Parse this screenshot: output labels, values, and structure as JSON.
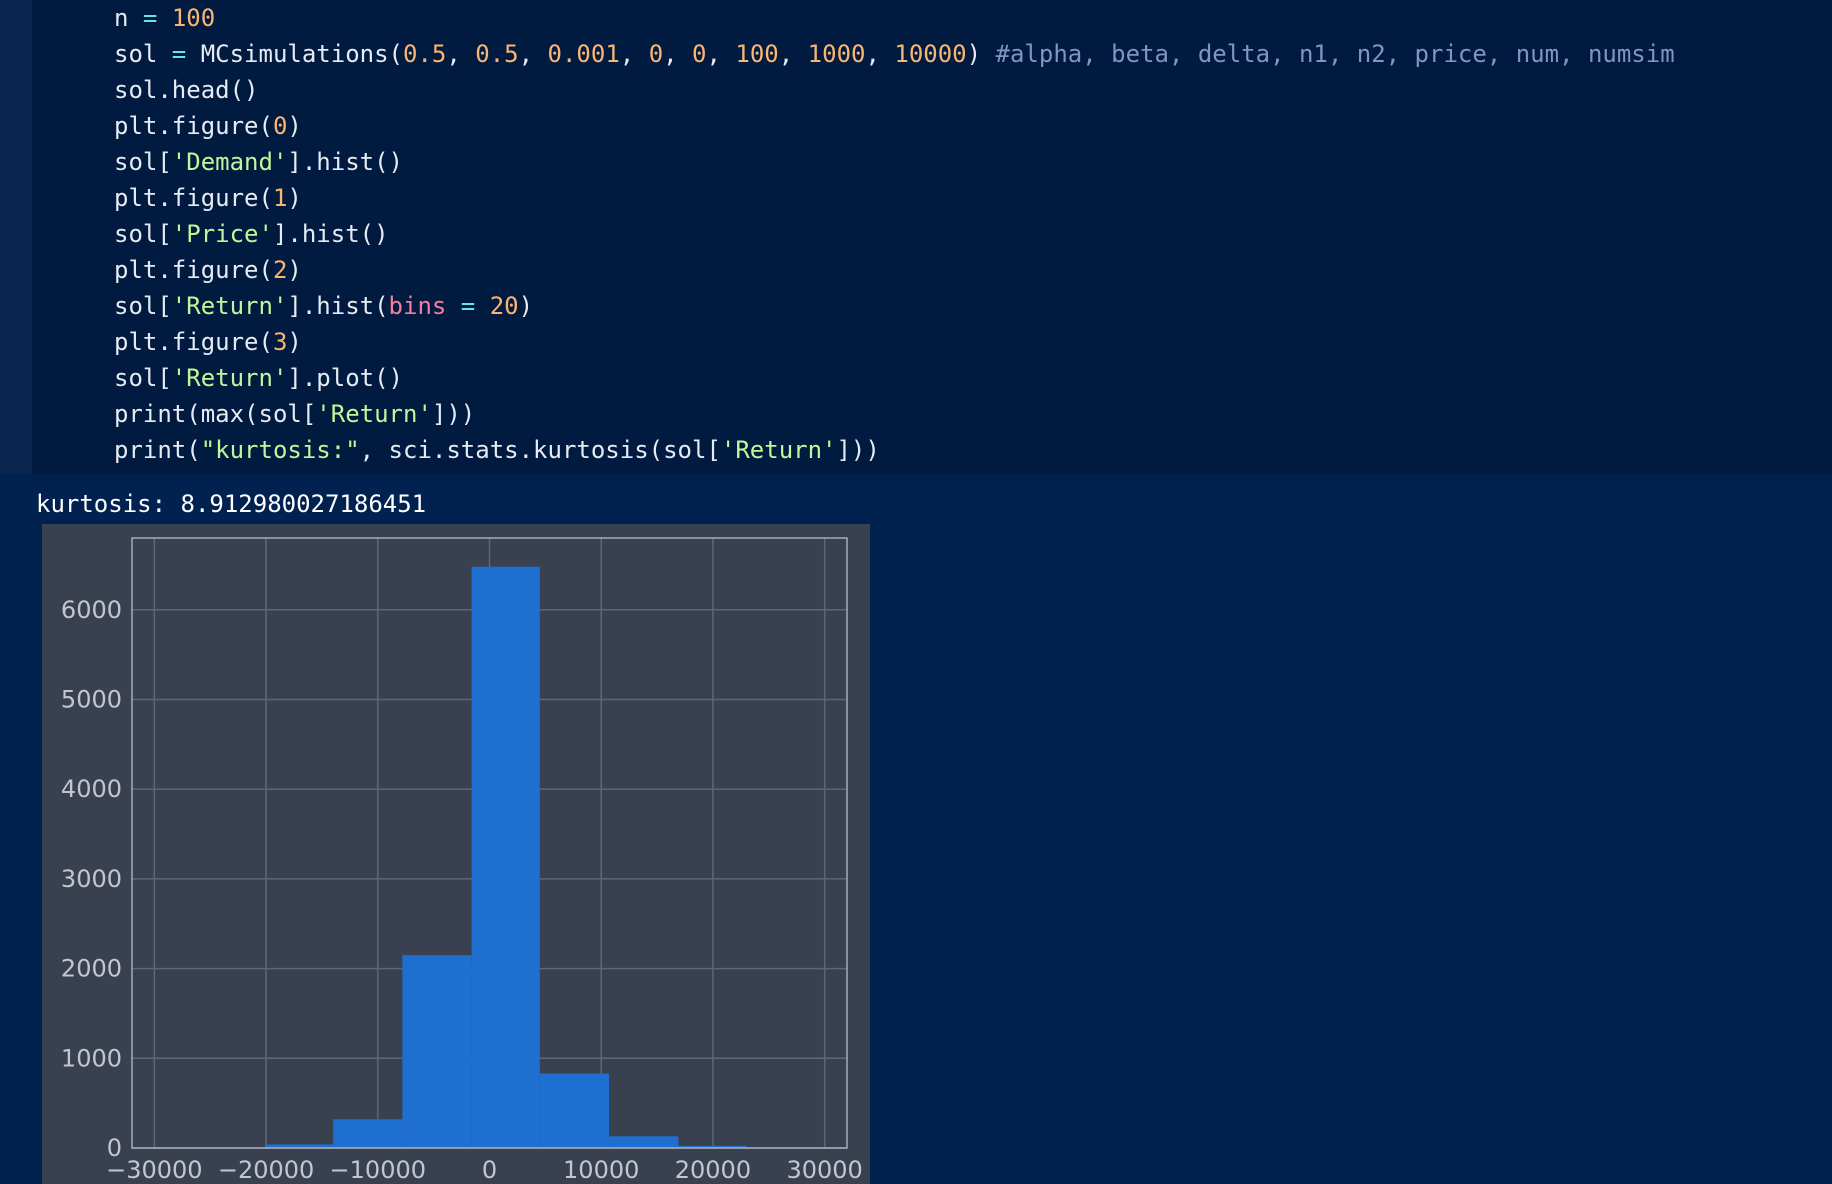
{
  "code_cell": {
    "lines": [
      [
        {
          "t": "n ",
          "c": "txt"
        },
        {
          "t": "=",
          "c": "op"
        },
        {
          "t": " ",
          "c": "txt"
        },
        {
          "t": "100",
          "c": "num"
        }
      ],
      [
        {
          "t": "sol ",
          "c": "txt"
        },
        {
          "t": "=",
          "c": "op"
        },
        {
          "t": " MCsimulations(",
          "c": "txt"
        },
        {
          "t": "0.5",
          "c": "num"
        },
        {
          "t": ", ",
          "c": "txt"
        },
        {
          "t": "0.5",
          "c": "num"
        },
        {
          "t": ", ",
          "c": "txt"
        },
        {
          "t": "0.001",
          "c": "num"
        },
        {
          "t": ", ",
          "c": "txt"
        },
        {
          "t": "0",
          "c": "num"
        },
        {
          "t": ", ",
          "c": "txt"
        },
        {
          "t": "0",
          "c": "num"
        },
        {
          "t": ", ",
          "c": "txt"
        },
        {
          "t": "100",
          "c": "num"
        },
        {
          "t": ", ",
          "c": "txt"
        },
        {
          "t": "1000",
          "c": "num"
        },
        {
          "t": ", ",
          "c": "txt"
        },
        {
          "t": "10000",
          "c": "num"
        },
        {
          "t": ") ",
          "c": "txt"
        },
        {
          "t": "#alpha, beta, delta, n1, n2, price, num, numsim",
          "c": "com"
        }
      ],
      [
        {
          "t": "sol.head()",
          "c": "txt"
        }
      ],
      [
        {
          "t": "plt.figure(",
          "c": "txt"
        },
        {
          "t": "0",
          "c": "num"
        },
        {
          "t": ")",
          "c": "txt"
        }
      ],
      [
        {
          "t": "sol[",
          "c": "txt"
        },
        {
          "t": "'Demand'",
          "c": "str"
        },
        {
          "t": "].hist()",
          "c": "txt"
        }
      ],
      [
        {
          "t": "plt.figure(",
          "c": "txt"
        },
        {
          "t": "1",
          "c": "num"
        },
        {
          "t": ")",
          "c": "txt"
        }
      ],
      [
        {
          "t": "sol[",
          "c": "txt"
        },
        {
          "t": "'Price'",
          "c": "str"
        },
        {
          "t": "].hist()",
          "c": "txt"
        }
      ],
      [
        {
          "t": "plt.figure(",
          "c": "txt"
        },
        {
          "t": "2",
          "c": "num"
        },
        {
          "t": ")",
          "c": "txt"
        }
      ],
      [
        {
          "t": "sol[",
          "c": "txt"
        },
        {
          "t": "'Return'",
          "c": "str"
        },
        {
          "t": "].hist(",
          "c": "txt"
        },
        {
          "t": "bins",
          "c": "kw"
        },
        {
          "t": " ",
          "c": "txt"
        },
        {
          "t": "=",
          "c": "op"
        },
        {
          "t": " ",
          "c": "txt"
        },
        {
          "t": "20",
          "c": "num"
        },
        {
          "t": ")",
          "c": "txt"
        }
      ],
      [
        {
          "t": "plt.figure(",
          "c": "txt"
        },
        {
          "t": "3",
          "c": "num"
        },
        {
          "t": ")",
          "c": "txt"
        }
      ],
      [
        {
          "t": "sol[",
          "c": "txt"
        },
        {
          "t": "'Return'",
          "c": "str"
        },
        {
          "t": "].plot()",
          "c": "txt"
        }
      ],
      [
        {
          "t": "print(max(sol[",
          "c": "txt"
        },
        {
          "t": "'Return'",
          "c": "str"
        },
        {
          "t": "]))",
          "c": "txt"
        }
      ],
      [
        {
          "t": "print(",
          "c": "txt"
        },
        {
          "t": "\"kurtosis:\"",
          "c": "str"
        },
        {
          "t": ", sci.stats.kurtosis(sol[",
          "c": "txt"
        },
        {
          "t": "'Return'",
          "c": "str"
        },
        {
          "t": "]))",
          "c": "txt"
        }
      ]
    ]
  },
  "output": {
    "text": "kurtosis: 8.912980027186451"
  },
  "colors": {
    "page_background": "#012150",
    "code_background": "#011a40",
    "plot_background": "#394150",
    "grid": "#5d677a",
    "bar": "#1f6fd0",
    "tick_text": "#c2c6cf"
  },
  "chart_data": {
    "type": "bar",
    "grid": true,
    "xlim": [
      -32000,
      32000
    ],
    "ylim": [
      0,
      6800
    ],
    "xticks": [
      -30000,
      -20000,
      -10000,
      0,
      10000,
      20000,
      30000
    ],
    "xtick_labels": [
      "−30000",
      "−20000",
      "−10000",
      "0",
      "10000",
      "20000",
      "30000"
    ],
    "yticks": [
      0,
      1000,
      2000,
      3000,
      4000,
      5000,
      6000
    ],
    "ytick_labels": [
      "0",
      "1000",
      "2000",
      "3000",
      "4000",
      "5000",
      "6000"
    ],
    "bins": [
      {
        "x0": -20100,
        "x1": -14000,
        "count": 40
      },
      {
        "x0": -14000,
        "x1": -7800,
        "count": 320
      },
      {
        "x0": -7800,
        "x1": -1600,
        "count": 2150
      },
      {
        "x0": -1600,
        "x1": 4500,
        "count": 6480
      },
      {
        "x0": 4500,
        "x1": 10700,
        "count": 830
      },
      {
        "x0": 10700,
        "x1": 16900,
        "count": 130
      },
      {
        "x0": 16900,
        "x1": 23000,
        "count": 25
      }
    ]
  }
}
